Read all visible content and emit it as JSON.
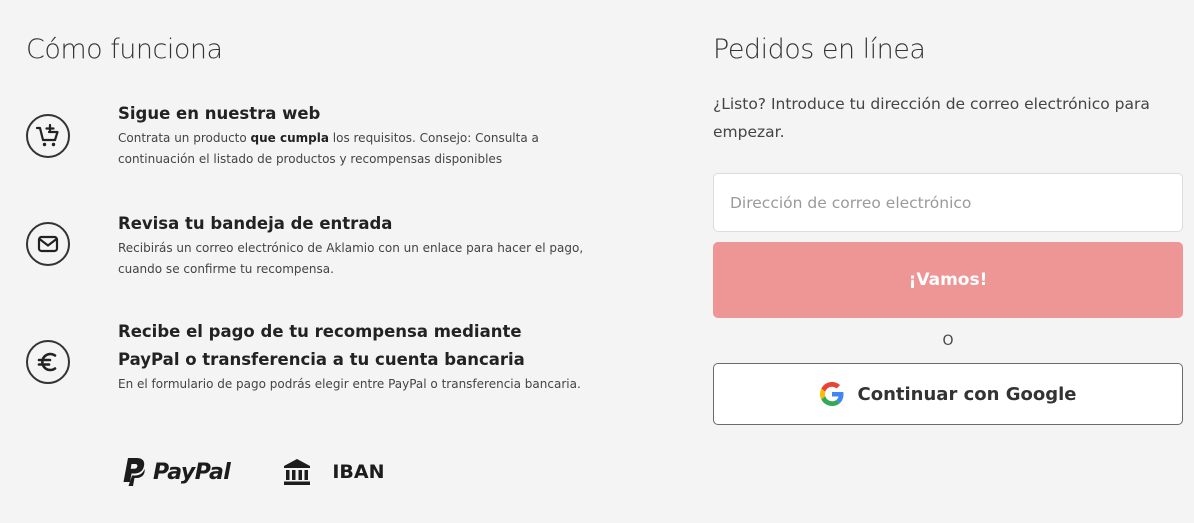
{
  "how_it_works": {
    "title": "Cómo funciona",
    "steps": [
      {
        "icon": "cart-icon",
        "title": "Sigue en nuestra web",
        "text_before": "Contrata un producto ",
        "text_bold": "que cumpla",
        "text_after": " los requisitos. Consejo: Consulta a continuación el listado de productos y recompensas disponibles"
      },
      {
        "icon": "mail-icon",
        "title": "Revisa tu bandeja de entrada",
        "text": "Recibirás un correo electrónico de Aklamio con un enlace para hacer el pago, cuando se confirme tu recompensa."
      },
      {
        "icon": "euro-icon",
        "title": "Recibe el pago de tu recompensa mediante PayPal o transferencia a tu cuenta bancaria",
        "text": "En el formulario de pago podrás elegir entre PayPal o transferencia bancaria."
      }
    ],
    "payment_methods": {
      "paypal": "PayPal",
      "iban": "IBAN"
    }
  },
  "online_orders": {
    "title": "Pedidos en línea",
    "intro": "¿Listo? Introduce tu dirección de correo electrónico para empezar.",
    "email_placeholder": "Dirección de correo electrónico",
    "submit_label": "¡Vamos!",
    "or_label": "O",
    "google_label": "Continuar con Google"
  },
  "colors": {
    "background": "#f4f4f4",
    "primary_button": "#ee9696",
    "text": "#333333"
  }
}
